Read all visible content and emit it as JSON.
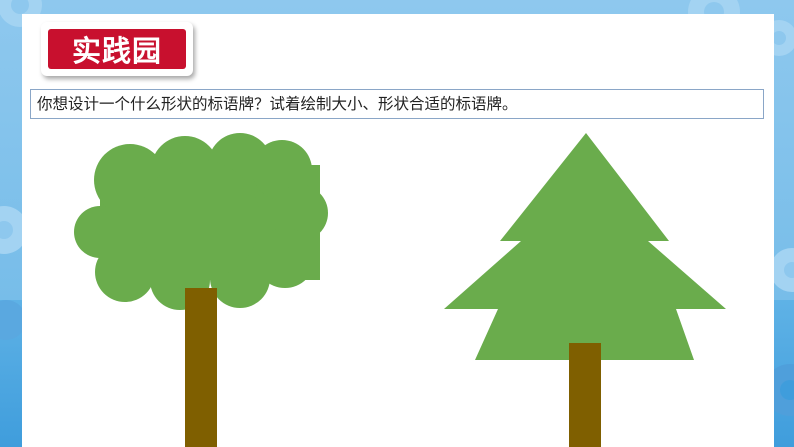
{
  "title_badge": {
    "text": "实践园"
  },
  "prompt": {
    "text": "你想设计一个什么形状的标语牌？试着绘制大小、形状合适的标语牌。"
  },
  "colors": {
    "title_red": "#c8102e",
    "foliage_green": "#6aac4c",
    "trunk_brown": "#7f5f00",
    "background_blue": "#7fc0ea"
  },
  "illustrations": [
    {
      "name": "round-tree",
      "shape": "cloud-canopy"
    },
    {
      "name": "pine-tree",
      "shape": "triangular-tiers"
    }
  ]
}
